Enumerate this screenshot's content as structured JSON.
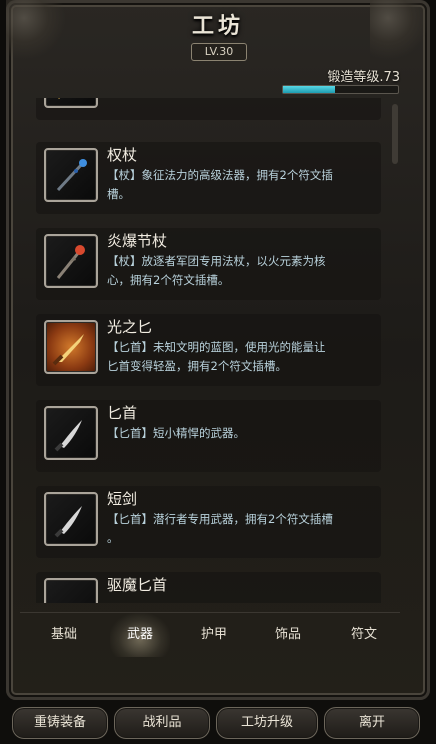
{
  "header": {
    "title": "工坊",
    "level_badge": "LV.30",
    "forge_label": "锻造等级.73",
    "forge_progress": 0.45
  },
  "items": [
    {
      "name": "",
      "desc_line1": "【 】 … … … … …",
      "desc_line2": "",
      "icon": "unknown-item-icon"
    },
    {
      "name": "权杖",
      "desc_line1": "【杖】象征法力的高级法器，拥有2个符文插",
      "desc_line2": "槽。",
      "icon": "scepter-icon"
    },
    {
      "name": "炎爆节杖",
      "desc_line1": "【杖】放逐者军团专用法杖，以火元素为核",
      "desc_line2": "心，拥有2个符文插槽。",
      "icon": "fire-staff-icon"
    },
    {
      "name": "光之匕",
      "desc_line1": "【匕首】未知文明的蓝图，使用光的能量让",
      "desc_line2": "匕首变得轻盈，拥有2个符文插槽。",
      "icon": "light-dagger-icon"
    },
    {
      "name": "匕首",
      "desc_line1": "【匕首】短小精悍的武器。",
      "desc_line2": "",
      "icon": "dagger-icon"
    },
    {
      "name": "短剑",
      "desc_line1": "【匕首】潜行者专用武器，拥有2个符文插槽",
      "desc_line2": "。",
      "icon": "short-sword-icon"
    },
    {
      "name": "驱魔匕首",
      "desc_line1": "",
      "desc_line2": "",
      "icon": "exorcism-dagger-icon"
    }
  ],
  "tabs": [
    {
      "label": "基础"
    },
    {
      "label": "武器"
    },
    {
      "label": "护甲"
    },
    {
      "label": "饰品"
    },
    {
      "label": "符文"
    }
  ],
  "bottom_buttons": [
    {
      "label": "重铸装备"
    },
    {
      "label": "战利品"
    },
    {
      "label": "工坊升级"
    },
    {
      "label": "离开"
    }
  ],
  "colors": {
    "accent": "#3cc4d6",
    "desc_text": "#b9d2dc"
  }
}
